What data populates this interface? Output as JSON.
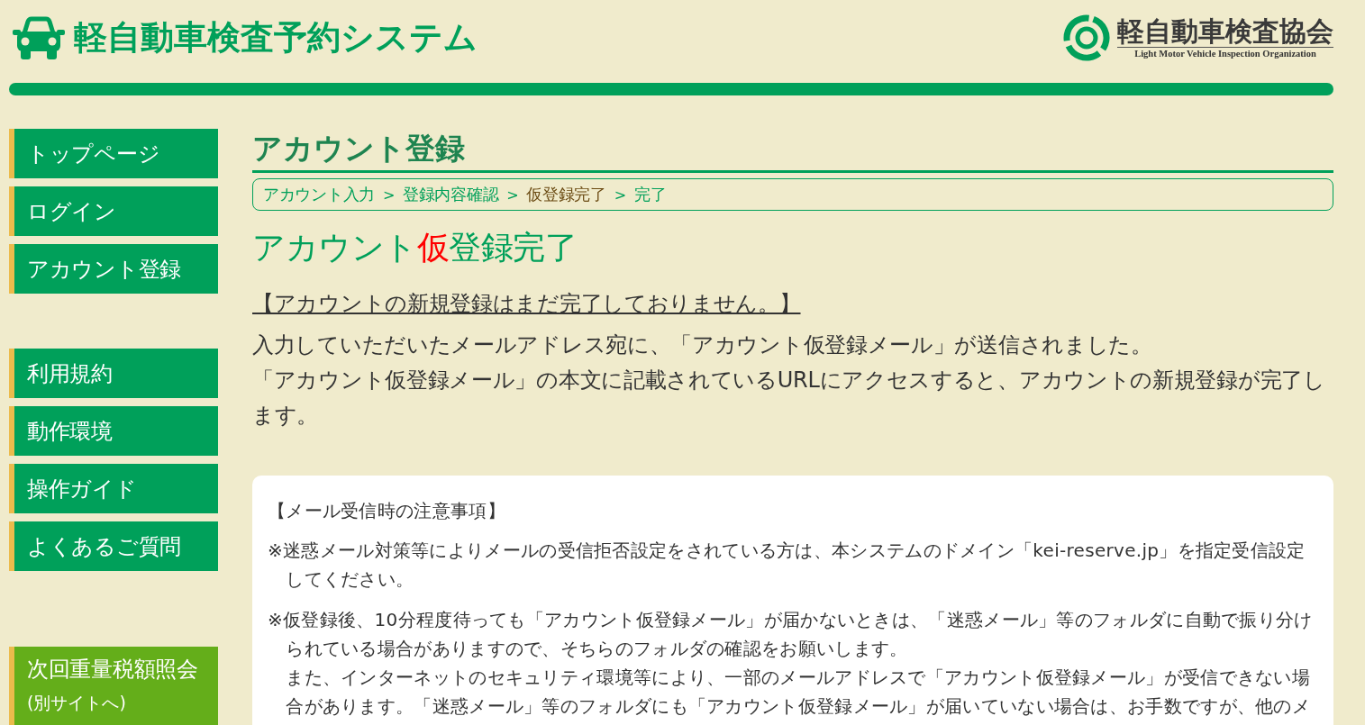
{
  "header": {
    "site_title": "軽自動車検査予約システム",
    "org_logo": {
      "name": "軽自動車検査協会",
      "english_name": "Light Motor Vehicle Inspection Organization"
    }
  },
  "sidebar": {
    "groups": [
      {
        "items": [
          {
            "label": "トップページ",
            "kind": "internal"
          },
          {
            "label": "ログイン",
            "kind": "internal"
          },
          {
            "label": "アカウント登録",
            "kind": "internal"
          }
        ]
      },
      {
        "items": [
          {
            "label": "利用規約",
            "kind": "internal"
          },
          {
            "label": "動作環境",
            "kind": "internal"
          },
          {
            "label": "操作ガイド",
            "kind": "internal"
          },
          {
            "label": "よくあるご質問",
            "kind": "internal"
          }
        ]
      },
      {
        "items": [
          {
            "label": "次回重量税額照会",
            "note": "(別サイトへ)",
            "kind": "external"
          }
        ]
      }
    ]
  },
  "main": {
    "heading": "アカウント登録",
    "breadcrumb": {
      "steps": [
        {
          "label": "アカウント入力",
          "selected": false
        },
        {
          "label": "登録内容確認",
          "selected": false
        },
        {
          "label": "仮登録完了",
          "selected": true
        },
        {
          "label": "完了",
          "selected": false
        }
      ],
      "separators": [
        ">",
        ">",
        ">"
      ]
    },
    "page_title": [
      {
        "text": "アカウント",
        "highlight": false
      },
      {
        "text": "仮",
        "highlight": true
      },
      {
        "text": "登録完了",
        "highlight": false
      }
    ],
    "warning": "【アカウントの新規登録はまだ完了しておりません。】",
    "paragraphs": [
      "入力していただいたメールアドレス宛に、「アカウント仮登録メール」が送信されました。",
      "「アカウント仮登録メール」の本文に記載されているURLにアクセスすると、アカウントの新規登録が完了します。"
    ],
    "mail_notes": {
      "heading": "【メール受信時の注意事項】",
      "items": [
        {
          "paragraphs": [
            "※迷惑メール対策等によりメールの受信拒否設定をされている方は、本システムのドメイン「kei-reserve.jp」を指定受信設定してください。"
          ]
        },
        {
          "paragraphs": [
            "※仮登録後、10分程度待っても「アカウント仮登録メール」が届かないときは、「迷惑メール」等のフォルダに自動で振り分けられている場合がありますので、そちらのフォルダの確認をお願いします。",
            "また、インターネットのセキュリティ環境等により、一部のメールアドレスで「アカウント仮登録メール」が受信できない場合があります。「迷惑メール」等のフォルダにも「アカウント仮登録メール」が届いていない場合は、お手数ですが、他のメ"
          ]
        }
      ]
    }
  }
}
